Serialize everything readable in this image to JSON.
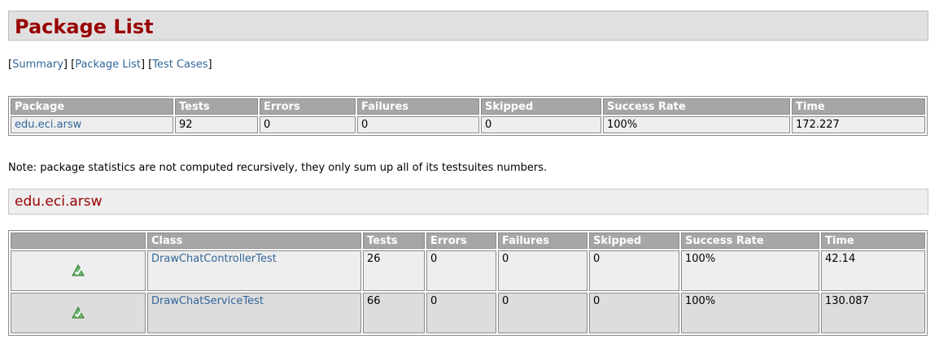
{
  "page": {
    "title": "Package List"
  },
  "nav": {
    "summary": "Summary",
    "package_list": "Package List",
    "test_cases": "Test Cases"
  },
  "package_table": {
    "headers": [
      "Package",
      "Tests",
      "Errors",
      "Failures",
      "Skipped",
      "Success Rate",
      "Time"
    ],
    "rows": [
      {
        "package": "edu.eci.arsw",
        "tests": "92",
        "errors": "0",
        "failures": "0",
        "skipped": "0",
        "success_rate": "100%",
        "time": "172.227"
      }
    ]
  },
  "note": "Note: package statistics are not computed recursively, they only sum up all of its testsuites numbers.",
  "package_section": {
    "heading": "edu.eci.arsw"
  },
  "class_table": {
    "headers": [
      "",
      "Class",
      "Tests",
      "Errors",
      "Failures",
      "Skipped",
      "Success Rate",
      "Time"
    ],
    "rows": [
      {
        "status_icon": "check-icon",
        "class": "DrawChatControllerTest",
        "tests": "26",
        "errors": "0",
        "failures": "0",
        "skipped": "0",
        "success_rate": "100%",
        "time": "42.14"
      },
      {
        "status_icon": "check-icon",
        "class": "DrawChatServiceTest",
        "tests": "66",
        "errors": "0",
        "failures": "0",
        "skipped": "0",
        "success_rate": "100%",
        "time": "130.087"
      }
    ]
  },
  "colors": {
    "title": "#990000",
    "link": "#336699",
    "header_bg": "#a6a6a6",
    "row_a": "#eeeeee",
    "row_b": "#dddddd",
    "icon_green": "#3fa33f"
  }
}
